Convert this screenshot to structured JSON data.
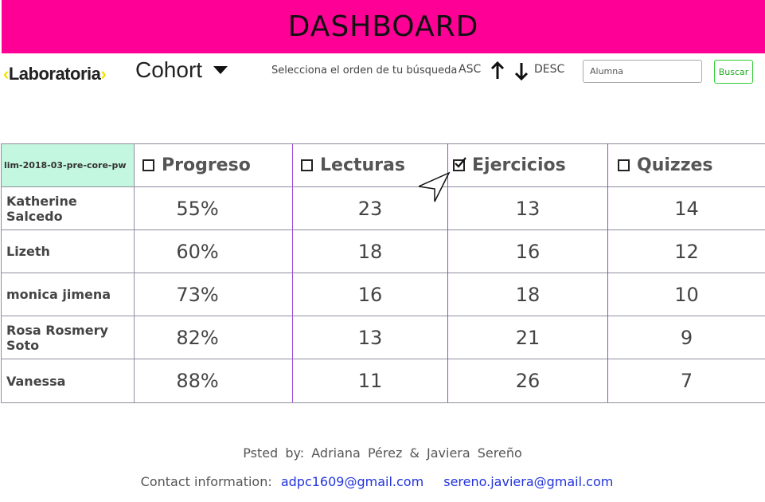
{
  "header": {
    "title": "DASHBOARD"
  },
  "toolbar": {
    "logo_bracket_left": "‹",
    "logo_text": "Laboratoria",
    "logo_bracket_right": "›",
    "cohort_label": "Cohort",
    "order_label": "Selecciona el orden de tu búsqueda",
    "asc_label": "ASC",
    "desc_label": "DESC",
    "search_placeholder": "Alumna",
    "search_button": "Buscar"
  },
  "table": {
    "cohort": "lim-2018-03-pre-core-pw",
    "columns": [
      {
        "label": "Progreso",
        "checked": false
      },
      {
        "label": "Lecturas",
        "checked": false
      },
      {
        "label": "Ejercicios",
        "checked": true
      },
      {
        "label": "Quizzes",
        "checked": false
      }
    ],
    "rows": [
      {
        "name": "Katherine Salcedo",
        "progreso": "55%",
        "lecturas": "23",
        "ejercicios": "13",
        "quizzes": "14"
      },
      {
        "name": "Lizeth",
        "progreso": "60%",
        "lecturas": "18",
        "ejercicios": "16",
        "quizzes": "12"
      },
      {
        "name": "monica jimena",
        "progreso": "73%",
        "lecturas": "16",
        "ejercicios": "18",
        "quizzes": "10"
      },
      {
        "name": "Rosa Rosmery Soto",
        "progreso": "82%",
        "lecturas": "13",
        "ejercicios": "21",
        "quizzes": "9"
      },
      {
        "name": "Vanessa",
        "progreso": "88%",
        "lecturas": "11",
        "ejercicios": "26",
        "quizzes": "7"
      }
    ]
  },
  "footer": {
    "posted_label": "Psted",
    "by_label": "by:",
    "author1": "Adriana Pérez",
    "amp": "&",
    "author2": "Javiera Sereño",
    "contact_label": "Contact information:",
    "email1": "adpc1609@gmail.com",
    "email2": "sereno.javiera@gmail.com"
  },
  "colors": {
    "banner": "#ff0096",
    "cohort_cell": "#c4f7df",
    "link": "#2233dd",
    "accent_line": "#9a4ad8",
    "logo_bracket": "#f4e300"
  }
}
